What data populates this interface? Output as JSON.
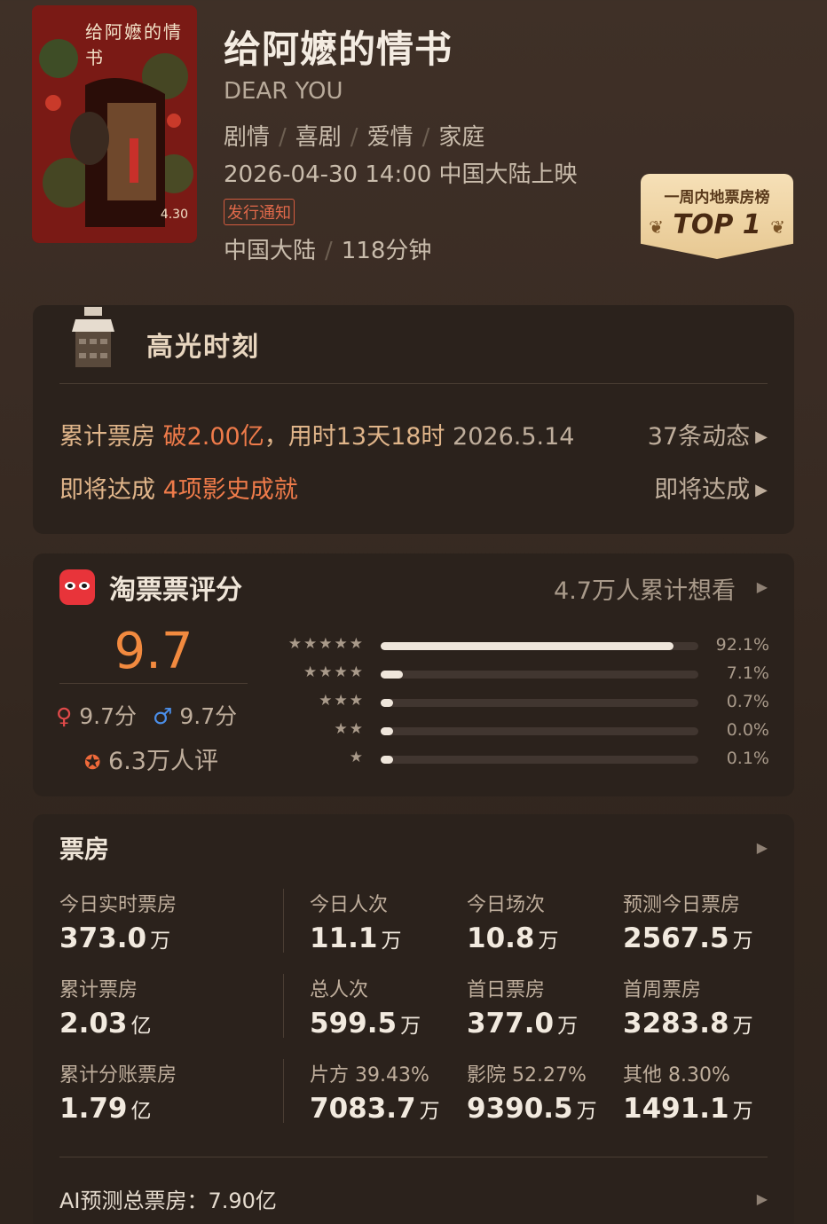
{
  "movie": {
    "title": "给阿嬷的情书",
    "title_en": "DEAR YOU",
    "genres": [
      "剧情",
      "喜剧",
      "爱情",
      "家庭"
    ],
    "release": "2026-04-30 14:00 中国大陆上映",
    "release_tag": "发行通知",
    "region": "中国大陆",
    "duration": "118分钟",
    "poster_title": "给阿嬷的情书",
    "poster_date": "4.30"
  },
  "badge": {
    "line1": "一周内地票房榜",
    "line2": "TOP 1"
  },
  "highlight": {
    "title": "高光时刻",
    "row1_prefix": "累计票房 ",
    "row1_accent": "破2.00亿",
    "row1_suffix": "，用时13天18时",
    "row1_date": "2026.5.14",
    "row1_link": "37条动态",
    "row2_prefix": "即将达成 ",
    "row2_accent": "4项影史成就",
    "row2_link": "即将达成"
  },
  "rating": {
    "title": "淘票票评分",
    "want_text": "4.7万人累计想看",
    "score": "9.7",
    "female_score": "9.7分",
    "male_score": "9.7分",
    "rater_count": "6.3万人评",
    "distribution": [
      {
        "stars": "★★★★★",
        "value": 92.1,
        "label": "92.1%"
      },
      {
        "stars": "★★★★",
        "value": 7.1,
        "label": "7.1%"
      },
      {
        "stars": "★★★",
        "value": 0.7,
        "label": "0.7%"
      },
      {
        "stars": "★★",
        "value": 0.0,
        "label": "0.0%"
      },
      {
        "stars": "★",
        "value": 0.1,
        "label": "0.1%"
      }
    ]
  },
  "boxoffice": {
    "title": "票房",
    "today_realtime_label": "今日实时票房",
    "today_realtime_value": "373.0",
    "today_realtime_unit": "万",
    "today_viewers_label": "今日人次",
    "today_viewers_value": "11.1",
    "today_viewers_unit": "万",
    "today_shows_label": "今日场次",
    "today_shows_value": "10.8",
    "today_shows_unit": "万",
    "forecast_today_label": "预测今日票房",
    "forecast_today_value": "2567.5",
    "forecast_today_unit": "万",
    "total_label": "累计票房",
    "total_value": "2.03",
    "total_unit": "亿",
    "total_viewers_label": "总人次",
    "total_viewers_value": "599.5",
    "total_viewers_unit": "万",
    "first_day_label": "首日票房",
    "first_day_value": "377.0",
    "first_day_unit": "万",
    "first_week_label": "首周票房",
    "first_week_value": "3283.8",
    "first_week_unit": "万",
    "split_total_label": "累计分账票房",
    "split_total_value": "1.79",
    "split_total_unit": "亿",
    "producer_label": "片方 39.43%",
    "producer_value": "7083.7",
    "producer_unit": "万",
    "cinema_label": "影院 52.27%",
    "cinema_value": "9390.5",
    "cinema_unit": "万",
    "other_label": "其他 8.30%",
    "other_value": "1491.1",
    "other_unit": "万",
    "ai_forecast": "AI预测总票房：7.90亿"
  }
}
